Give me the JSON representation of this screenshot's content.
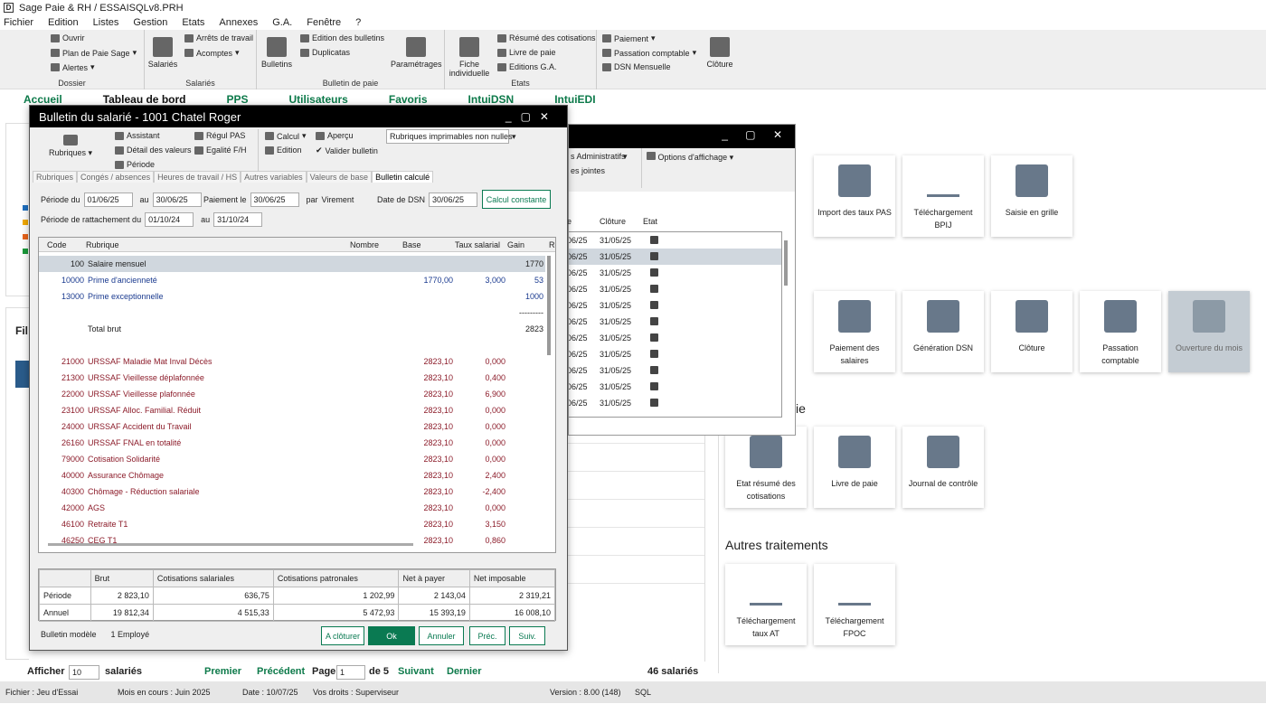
{
  "window": {
    "title": "Sage Paie & RH / ESSAISQLv8.PRH"
  },
  "menu": [
    "Fichier",
    "Edition",
    "Listes",
    "Gestion",
    "Etats",
    "Annexes",
    "G.A.",
    "Fenêtre",
    "?"
  ],
  "ribbon": {
    "dossier": {
      "title": "Dossier",
      "items": [
        "Ouvrir",
        "Plan de Paie Sage",
        "Alertes"
      ]
    },
    "salaries": {
      "title": "Salariés",
      "big": "Salariés",
      "items": [
        "Arrêts de travail",
        "Acomptes"
      ]
    },
    "bulletin": {
      "title": "Bulletin de paie",
      "big": "Bulletins",
      "items": [
        "Edition des bulletins",
        "Duplicatas"
      ],
      "param": "Paramétrages"
    },
    "etats": {
      "title": "Etats",
      "big": "Fiche individuelle",
      "items": [
        "Résumé des cotisations",
        "Livre de paie",
        "Editions G.A."
      ]
    },
    "paiement": {
      "items": [
        "Paiement",
        "Passation comptable",
        "DSN Mensuelle"
      ],
      "big": "Clôture"
    }
  },
  "nav": [
    "Accueil",
    "Tableau de bord",
    "PPS",
    "Utilisateurs",
    "Favoris",
    "IntuiDSN",
    "IntuiEDI"
  ],
  "tiles_top": [
    "Import des taux PAS",
    "Téléchargement BPIJ",
    "Saisie en grille"
  ],
  "tiles_mid": [
    "Paiement des salaires",
    "Génération DSN",
    "Clôture",
    "Passation comptable",
    "Ouverture du mois"
  ],
  "section_etats_suffix": "ie",
  "tiles_etats": [
    "Etat résumé des cotisations",
    "Livre de paie",
    "Journal de contrôle"
  ],
  "section_autres": "Autres traitements",
  "tiles_autres": [
    "Téléchargement taux AT",
    "Téléchargement FPOC"
  ],
  "bgwin": {
    "toolbar": [
      "s Administratifs",
      "es jointes",
      "Options d'affichage"
    ],
    "cols": [
      "e",
      "Clôture",
      "Etat"
    ],
    "rows": [
      [
        "06/25",
        "31/05/25"
      ],
      [
        "06/25",
        "31/05/25"
      ],
      [
        "06/25",
        "31/05/25"
      ],
      [
        "06/25",
        "31/05/25"
      ],
      [
        "06/25",
        "31/05/25"
      ],
      [
        "06/25",
        "31/05/25"
      ],
      [
        "06/25",
        "31/05/25"
      ],
      [
        "06/25",
        "31/05/25"
      ],
      [
        "06/25",
        "31/05/25"
      ],
      [
        "06/25",
        "31/05/25"
      ],
      [
        "06/25",
        "31/05/25"
      ]
    ]
  },
  "bulletin": {
    "title": "Bulletin du salarié - 1001 Chatel Roger",
    "toolbar": {
      "rubriques": "Rubriques",
      "assistant": "Assistant",
      "detail": "Détail des valeurs",
      "periode": "Période",
      "regul": "Régul PAS",
      "egalite": "Egalité F/H",
      "calcul": "Calcul",
      "edition": "Edition",
      "apercu": "Aperçu",
      "valider": "Valider bulletin",
      "select": "Rubriques imprimables non nulles"
    },
    "tabs": [
      "Rubriques",
      "Congés / absences",
      "Heures de travail / HS",
      "Autres variables",
      "Valeurs de base",
      "Bulletin calculé"
    ],
    "fields": {
      "periode_du_label": "Période du",
      "periode_du": "01/06/25",
      "au_label": "au",
      "periode_au": "30/06/25",
      "paiement_label": "Paiement le",
      "paiement": "30/06/25",
      "par_label": "par",
      "par": "Virement",
      "dsn_label": "Date de DSN",
      "dsn": "30/06/25",
      "calc_btn": "Calcul constante",
      "ratt_label": "Période de rattachement du",
      "ratt_du": "01/10/24",
      "ratt_au_label": "au",
      "ratt_au": "31/10/24"
    },
    "grid_cols": [
      "Code",
      "Rubrique",
      "Nombre",
      "Base",
      "Taux salarial",
      "Gain",
      "Re"
    ],
    "rows": [
      {
        "code": "100",
        "label": "Salaire mensuel",
        "base": "",
        "taux": "",
        "gain": "1770",
        "c": ""
      },
      {
        "code": "10000",
        "label": "Prime d'ancienneté",
        "base": "1770,00",
        "taux": "3,000",
        "gain": "53",
        "c": "cblue"
      },
      {
        "code": "13000",
        "label": "Prime exceptionnelle",
        "base": "",
        "taux": "",
        "gain": "1000",
        "c": "cblue"
      },
      {
        "code": "",
        "label": "",
        "base": "",
        "taux": "",
        "gain": "---------",
        "c": ""
      },
      {
        "code": "",
        "label": "Total brut",
        "base": "",
        "taux": "",
        "gain": "2823",
        "c": ""
      },
      {
        "code": "",
        "label": "",
        "base": "",
        "taux": "",
        "gain": "",
        "c": ""
      },
      {
        "code": "21000",
        "label": "URSSAF Maladie Mat Inval Décès",
        "base": "2823,10",
        "taux": "0,000",
        "gain": "",
        "c": "cred"
      },
      {
        "code": "21300",
        "label": "URSSAF Vieillesse déplafonnée",
        "base": "2823,10",
        "taux": "0,400",
        "gain": "",
        "c": "cred"
      },
      {
        "code": "22000",
        "label": "URSSAF Vieillesse plafonnée",
        "base": "2823,10",
        "taux": "6,900",
        "gain": "",
        "c": "cred"
      },
      {
        "code": "23100",
        "label": "URSSAF Alloc. Familial. Réduit",
        "base": "2823,10",
        "taux": "0,000",
        "gain": "",
        "c": "cred"
      },
      {
        "code": "24000",
        "label": "URSSAF Accident du Travail",
        "base": "2823,10",
        "taux": "0,000",
        "gain": "",
        "c": "cred"
      },
      {
        "code": "26160",
        "label": "URSSAF FNAL en totalité",
        "base": "2823,10",
        "taux": "0,000",
        "gain": "",
        "c": "cred"
      },
      {
        "code": "79000",
        "label": "Cotisation Solidarité",
        "base": "2823,10",
        "taux": "0,000",
        "gain": "",
        "c": "cred"
      },
      {
        "code": "40000",
        "label": "Assurance Chômage",
        "base": "2823,10",
        "taux": "2,400",
        "gain": "",
        "c": "cred"
      },
      {
        "code": "40300",
        "label": "Chômage - Réduction salariale",
        "base": "2823,10",
        "taux": "-2,400",
        "gain": "",
        "c": "cred"
      },
      {
        "code": "42000",
        "label": "AGS",
        "base": "2823,10",
        "taux": "0,000",
        "gain": "",
        "c": "cred"
      },
      {
        "code": "46100",
        "label": "Retraite T1",
        "base": "2823,10",
        "taux": "3,150",
        "gain": "",
        "c": "cred"
      },
      {
        "code": "46250",
        "label": "CEG T1",
        "base": "2823,10",
        "taux": "0,860",
        "gain": "",
        "c": "cred"
      }
    ],
    "summary": {
      "headers": [
        "",
        "Brut",
        "Cotisations salariales",
        "Cotisations patronales",
        "Net à payer",
        "Net imposable"
      ],
      "rows": [
        [
          "Période",
          "2 823,10",
          "636,75",
          "1 202,99",
          "2 143,04",
          "2 319,21"
        ],
        [
          "Annuel",
          "19 812,34",
          "4 515,33",
          "5 472,93",
          "15 393,19",
          "16 008,10"
        ]
      ]
    },
    "footer": {
      "modele_label": "Bulletin modèle",
      "modele": "1 Employé",
      "btn_cloturer": "A clôturer",
      "btn_ok": "Ok",
      "btn_annuler": "Annuler",
      "btn_prec": "Préc.",
      "btn_suiv": "Suiv."
    }
  },
  "list_footer": {
    "afficher": "Afficher",
    "count": "10",
    "salaries": "salariés",
    "premier": "Premier",
    "precedent": "Précédent",
    "page": "Page",
    "page_num": "1",
    "de": "de 5",
    "suivant": "Suivant",
    "dernier": "Dernier",
    "total": "46 salariés"
  },
  "left_partial": "Fil",
  "status": {
    "fichier": "Fichier : Jeu d'Essai",
    "mois": "Mois en cours : Juin 2025",
    "date": "Date : 10/07/25",
    "droits": "Vos droits : Superviseur",
    "version": "Version : 8.00 (148)",
    "sql": "SQL"
  }
}
